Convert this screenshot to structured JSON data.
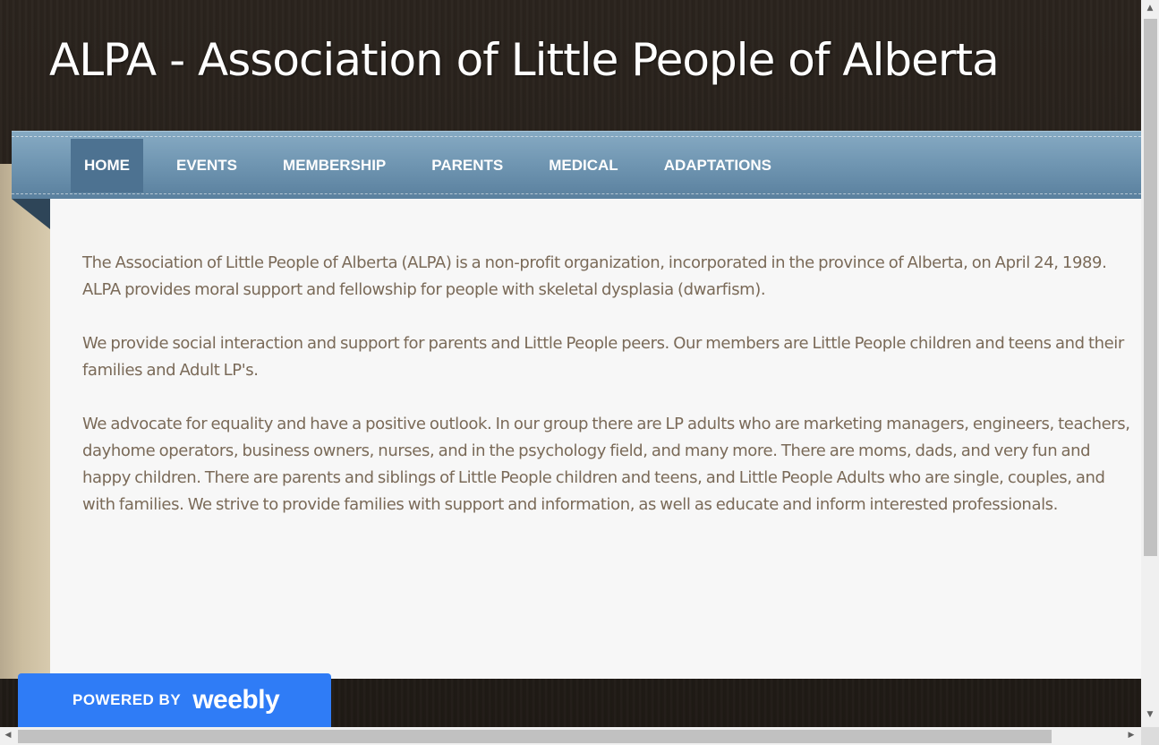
{
  "site": {
    "title": "ALPA - Association of Little People of Alberta"
  },
  "nav": {
    "items": [
      {
        "label": "HOME",
        "active": true
      },
      {
        "label": "EVENTS",
        "active": false
      },
      {
        "label": "MEMBERSHIP",
        "active": false
      },
      {
        "label": "PARENTS",
        "active": false
      },
      {
        "label": "MEDICAL",
        "active": false
      },
      {
        "label": "ADAPTATIONS",
        "active": false
      }
    ]
  },
  "content": {
    "paragraphs": [
      "The Association of Little People of Alberta (ALPA) is a non-profit organization, incorporated in the province of Alberta, on April 24, 1989.  ALPA provides moral support and fellowship for people with skeletal dysplasia (dwarfism).",
      "We provide social interaction and support for parents and Little People peers. Our members are Little People children and teens and their families and Adult LP's.",
      "We advocate for equality and have a positive outlook. In our group there are LP adults who are marketing managers, engineers, teachers, dayhome operators, business owners, nurses, and in the psychology field, and many more. There are moms, dads, and very fun and happy children. There are parents and siblings of Little People children and teens, and Little People Adults who are single, couples, and with families. We strive to provide families with support and information, as well as educate and inform interested professionals."
    ]
  },
  "badge": {
    "prefix": "POWERED BY",
    "brand": "weebly",
    "color": "#2f7cf6"
  },
  "scrollbars": {
    "up_icon": "▲",
    "down_icon": "▼",
    "left_icon": "◀",
    "right_icon": "▶"
  }
}
